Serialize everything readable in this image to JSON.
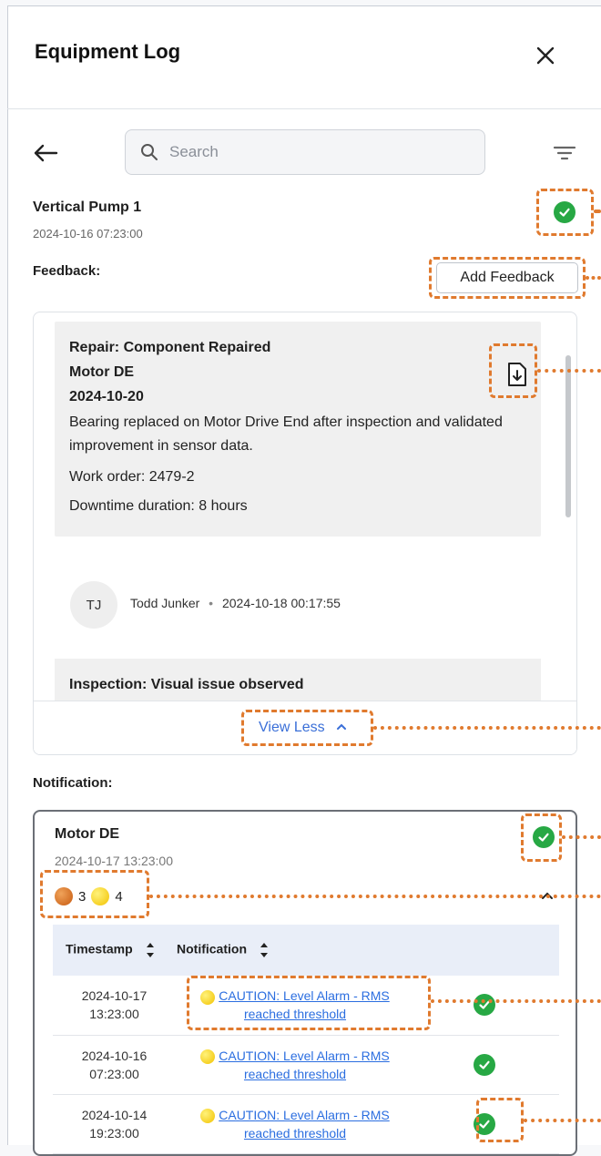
{
  "header": {
    "title": "Equipment Log"
  },
  "search": {
    "placeholder": "Search"
  },
  "asset": {
    "name": "Vertical Pump 1",
    "timestamp": "2024-10-16 07:23:00"
  },
  "feedback": {
    "label": "Feedback:",
    "add_button": "Add Feedback",
    "entries": [
      {
        "title": "Repair: Component Repaired",
        "component": "Motor DE",
        "date": "2024-10-20",
        "description": "Bearing replaced on Motor Drive End after inspection and validated improvement in sensor data.",
        "work_order": "Work order: 2479-2",
        "downtime": "Downtime duration: 8 hours"
      },
      {
        "title": "Inspection: Visual issue observed"
      }
    ],
    "author": {
      "initials": "TJ",
      "name": "Todd Junker",
      "timestamp": "2024-10-18 00:17:55"
    },
    "view_less": "View Less"
  },
  "notification": {
    "label": "Notification:",
    "asset": "Motor DE",
    "timestamp": "2024-10-17 13:23:00",
    "counts": {
      "orange": "3",
      "yellow": "4"
    },
    "columns": [
      "Timestamp",
      "Notification"
    ],
    "rows": [
      {
        "date": "2024-10-17",
        "time": "13:23:00",
        "line1": "CAUTION: Level Alarm - RMS",
        "line2": "reached threshold"
      },
      {
        "date": "2024-10-16",
        "time": "07:23:00",
        "line1": "CAUTION: Level Alarm - RMS",
        "line2": "reached threshold"
      },
      {
        "date": "2024-10-14",
        "time": "19:23:00",
        "line1": "CAUTION: Level Alarm - RMS",
        "line2": "reached threshold"
      }
    ]
  },
  "colors": {
    "annotation": "#e07a2e",
    "status_ok": "#27a844",
    "link": "#2b6ee0",
    "warning_orange": "#d9781f",
    "warning_yellow": "#f6cf1c"
  },
  "icons": [
    "close-icon",
    "back-arrow-icon",
    "search-icon",
    "filter-icon",
    "check-circle-icon",
    "download-file-icon",
    "chevron-up-icon",
    "sort-icon",
    "warning-orange-dot-icon",
    "warning-yellow-dot-icon"
  ]
}
